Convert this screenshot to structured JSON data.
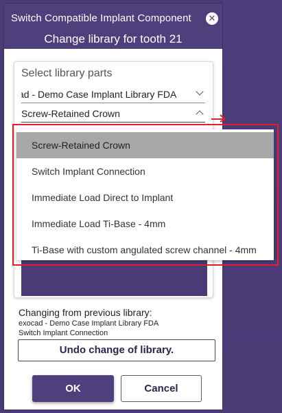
{
  "dialog": {
    "title": "Switch Compatible Implant Component",
    "subtitle": "Change library for tooth 21",
    "close_icon": "close-icon"
  },
  "parts": {
    "heading": "Select library parts",
    "library_select_value": "ad - Demo Case Implant Library FDA",
    "component_select_value": "Screw-Retained Crown"
  },
  "dropdown": {
    "options": [
      "Screw-Retained Crown",
      "Switch Implant Connection",
      "Immediate Load Direct to Implant",
      "Immediate Load Ti-Base - 4mm",
      "Ti-Base with custom angulated screw channel - 4mm"
    ],
    "selected_index": 0
  },
  "previous": {
    "label": "Changing from previous library:",
    "library": "exocad - Demo Case Implant Library FDA",
    "component": "Switch Implant Connection"
  },
  "buttons": {
    "undo": "Undo change of library.",
    "ok": "OK",
    "cancel": "Cancel"
  },
  "colors": {
    "brand": "#4f3f7d",
    "highlight_frame": "#e0202a",
    "selected_option": "#a7a7a7"
  }
}
